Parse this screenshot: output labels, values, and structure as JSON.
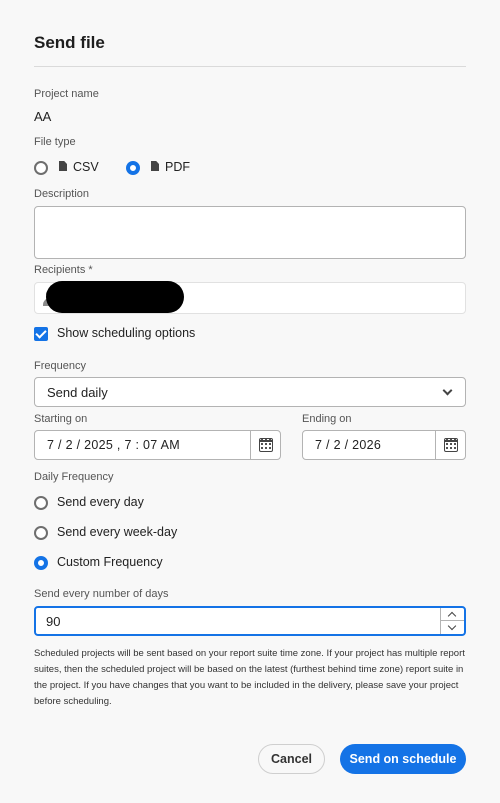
{
  "dialog": {
    "title": "Send file"
  },
  "project": {
    "label": "Project name",
    "value": "AA"
  },
  "file_type": {
    "label": "File type",
    "options": [
      {
        "label": "CSV",
        "checked": false
      },
      {
        "label": "PDF",
        "checked": true
      }
    ]
  },
  "description": {
    "label": "Description",
    "value": ""
  },
  "recipients": {
    "label": "Recipients",
    "required_marker": "*"
  },
  "scheduling": {
    "checkbox_label": "Show scheduling options",
    "checked": true
  },
  "frequency": {
    "label": "Frequency",
    "selected": "Send daily"
  },
  "starting": {
    "label": "Starting on",
    "value": "7 / 2 / 2025 , 7 : 07  AM"
  },
  "ending": {
    "label": "Ending on",
    "value": "7 / 2 / 2026"
  },
  "daily_frequency": {
    "label": "Daily Frequency",
    "options": [
      {
        "label": "Send every day",
        "checked": false
      },
      {
        "label": "Send every week-day",
        "checked": false
      },
      {
        "label": "Custom Frequency",
        "checked": true
      }
    ]
  },
  "days": {
    "label": "Send every number of days",
    "value": "90"
  },
  "note": "Scheduled projects will be sent based on your report suite time zone. If your project has multiple report suites, then the scheduled project will be based on the latest (furthest behind time zone) report suite in the project. If you have changes that you want to be included in the delivery, please save your project before scheduling.",
  "buttons": {
    "cancel": "Cancel",
    "submit": "Send on schedule"
  },
  "colors": {
    "accent": "#1473e6",
    "background": "#f8f8f8"
  }
}
